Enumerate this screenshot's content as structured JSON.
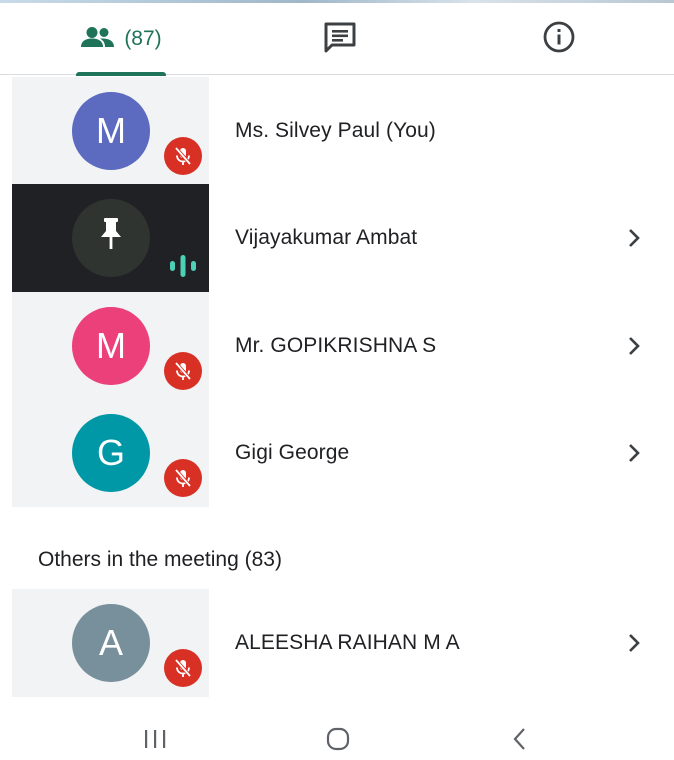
{
  "tabs": {
    "people_count": "(87)",
    "people_icon": "people-icon",
    "chat_icon": "chat-icon",
    "info_icon": "info-icon",
    "accent": "#1e7359"
  },
  "participants": [
    {
      "initial": "M",
      "name": "Ms. Silvey Paul (You)",
      "avatar_color": "#5c6bc0",
      "muted": true,
      "has_chevron": false
    },
    {
      "initial": "",
      "name": "Vijayakumar Ambat",
      "pinned": true,
      "speaking": true,
      "has_chevron": true
    },
    {
      "initial": "M",
      "name": "Mr. GOPIKRISHNA S",
      "avatar_color": "#ec407a",
      "muted": true,
      "has_chevron": true
    },
    {
      "initial": "G",
      "name": "Gigi George",
      "avatar_color": "#0097a7",
      "muted": true,
      "has_chevron": true
    }
  ],
  "others": {
    "heading": "Others in the meeting (83)",
    "participants": [
      {
        "initial": "A",
        "name": "ALEESHA RAIHAN M A",
        "avatar_color": "#78909c",
        "muted": true,
        "has_chevron": true
      }
    ]
  },
  "colors": {
    "mute_badge": "#d93025",
    "speaking": "#4dd0b5",
    "active_tile": "#202124"
  },
  "navbar": {
    "recent_icon": "recent-apps-icon",
    "home_icon": "home-icon",
    "back_icon": "back-icon"
  }
}
